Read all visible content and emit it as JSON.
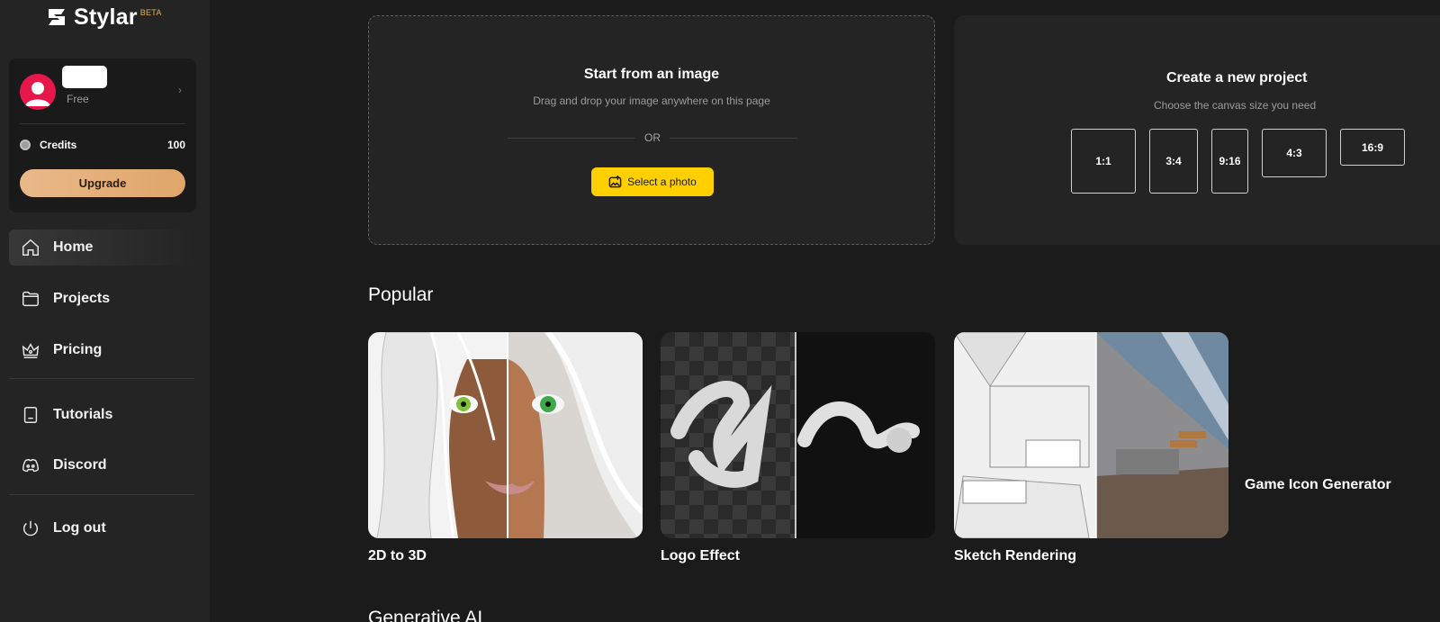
{
  "app": {
    "brand": "Stylar",
    "badge": "BETA"
  },
  "user": {
    "plan": "Free",
    "credits_label": "Credits",
    "credits_value": "100",
    "upgrade_label": "Upgrade"
  },
  "nav": {
    "items": [
      {
        "label": "Home",
        "icon": "home-icon",
        "active": true
      },
      {
        "label": "Projects",
        "icon": "folder-icon"
      },
      {
        "label": "Pricing",
        "icon": "crown-icon"
      },
      {
        "label": "Tutorials",
        "icon": "book-icon"
      },
      {
        "label": "Discord",
        "icon": "discord-icon"
      },
      {
        "label": "Log out",
        "icon": "power-icon"
      }
    ]
  },
  "upload": {
    "title": "Start from an image",
    "subtitle": "Drag and drop your image anywhere on this page",
    "or": "OR",
    "button_label": "Select a photo"
  },
  "new_project": {
    "title": "Create a new project",
    "subtitle": "Choose the canvas size you need",
    "ratios": [
      "1:1",
      "3:4",
      "9:16",
      "4:3",
      "16:9"
    ]
  },
  "popular": {
    "title": "Popular",
    "items": [
      {
        "label": "2D to 3D"
      },
      {
        "label": "Logo Effect"
      },
      {
        "label": "Sketch Rendering"
      },
      {
        "label": "Game Icon Generator"
      }
    ]
  },
  "generative": {
    "title": "Generative AI"
  },
  "colors": {
    "background": "#1b1b1b",
    "sidebar": "#242424",
    "accent_yellow": "#ffd000",
    "upgrade_gradient_start": "#e9b98a",
    "upgrade_gradient_end": "#dfa568",
    "avatar_red": "#e8174a"
  }
}
